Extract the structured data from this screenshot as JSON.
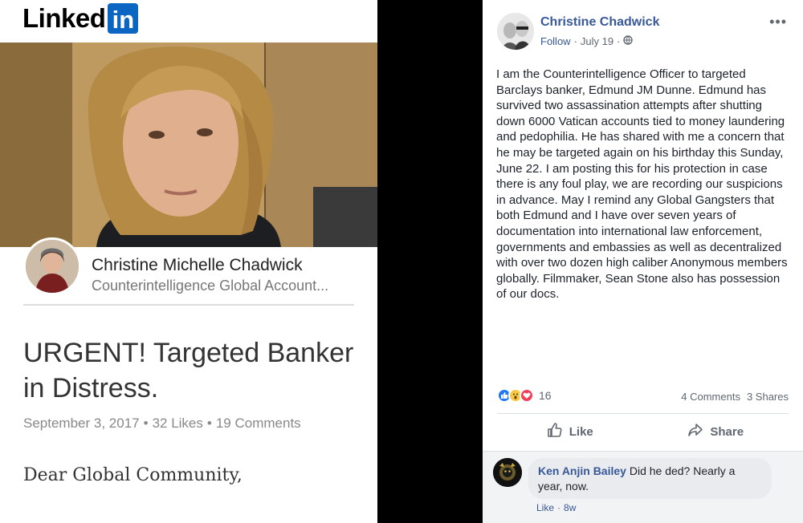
{
  "linkedin": {
    "logo_text": "Linked",
    "logo_box_text": "in",
    "author": {
      "name": "Christine Michelle Chadwick",
      "headline": "Counterintelligence Global Account..."
    },
    "article": {
      "title": "URGENT! Targeted Banker in Distress.",
      "date": "September 3, 2017",
      "likes": "32 Likes",
      "comments": "19 Comments",
      "body_start": "Dear Global Community,"
    }
  },
  "facebook": {
    "post": {
      "author_name": "Christine Chadwick",
      "follow_label": "Follow",
      "date": "July 19",
      "privacy_icon": "globe-icon",
      "more_icon": "ellipsis-icon",
      "text": "I am the Counterintelligence Officer to targeted Barclays banker, Edmund JM Dunne. Edmund has survived two assassination attempts after shutting down 6000 Vatican accounts tied to money laundering and pedophilia. He has shared with me a concern that he may be targeted again on his birthday this Sunday, June 22. I am posting this for his protection in case there is any foul play, we are recording our suspicions in advance. May I remind any Global Gangsters that both Edmund and I have over seven years of documentation into international law enforcement, governments and embassies as well as decentralized with over two dozen high caliber Anonymous members globally. Filmmaker, Sean Stone also has possession of our docs."
    },
    "reactions": {
      "icons": [
        "like-reaction-icon",
        "wow-reaction-icon",
        "love-reaction-icon"
      ],
      "count": "16",
      "comments_count": "4 Comments",
      "shares_count": "3 Shares"
    },
    "actions": {
      "like_label": "Like",
      "share_label": "Share"
    },
    "comment": {
      "author": "Ken Anjin Bailey",
      "text": "Did he ded? Nearly a year, now.",
      "like_label": "Like",
      "age": "8w"
    }
  },
  "colors": {
    "linkedin_blue": "#0a66c2",
    "facebook_link": "#385898",
    "separator": "#000000"
  }
}
